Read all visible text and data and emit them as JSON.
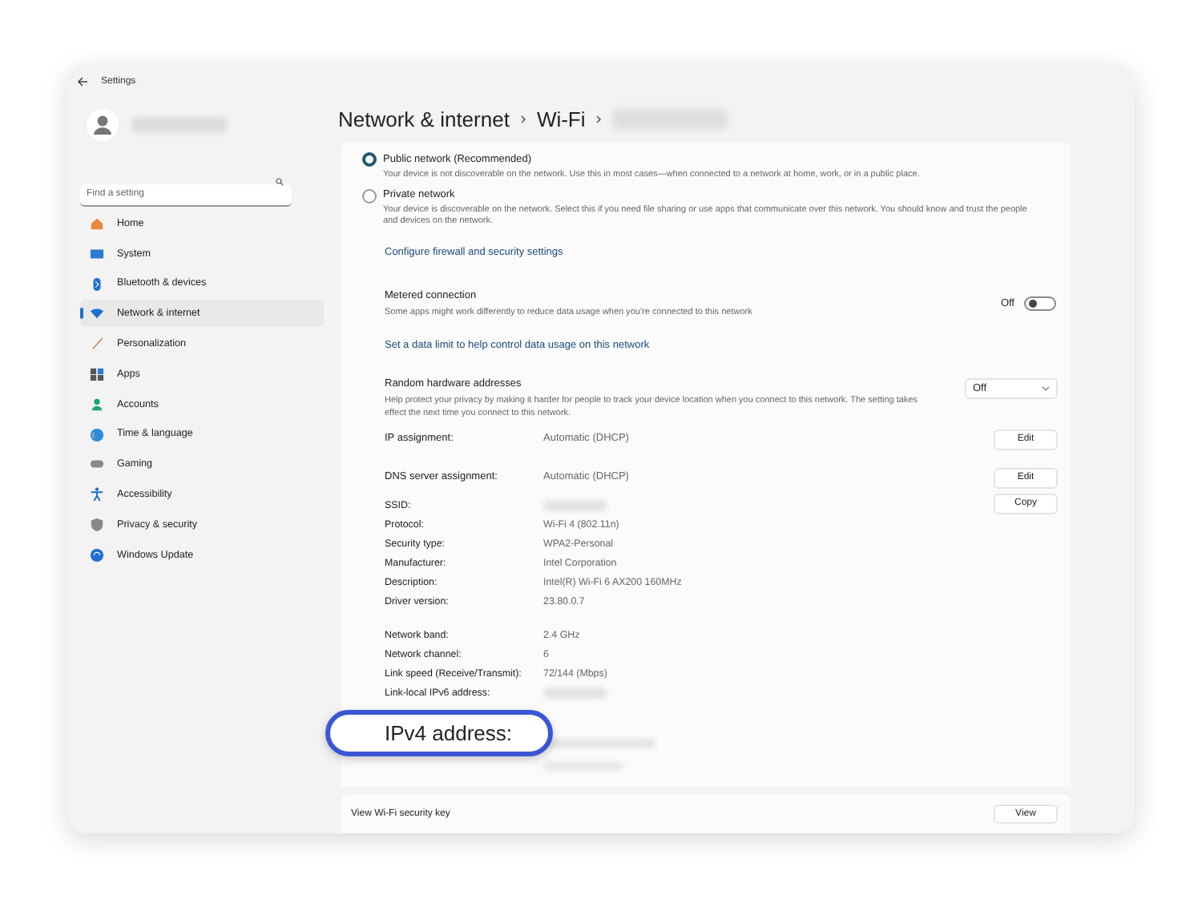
{
  "window": {
    "title": "Settings"
  },
  "sidebar": {
    "search": {
      "placeholder": "Find a setting"
    },
    "items": [
      {
        "label": "Home",
        "selected": false
      },
      {
        "label": "System",
        "selected": false
      },
      {
        "label": "Bluetooth & devices",
        "selected": false
      },
      {
        "label": "Network & internet",
        "selected": true
      },
      {
        "label": "Personalization",
        "selected": false
      },
      {
        "label": "Apps",
        "selected": false
      },
      {
        "label": "Accounts",
        "selected": false
      },
      {
        "label": "Time & language",
        "selected": false
      },
      {
        "label": "Gaming",
        "selected": false
      },
      {
        "label": "Accessibility",
        "selected": false
      },
      {
        "label": "Privacy & security",
        "selected": false
      },
      {
        "label": "Windows Update",
        "selected": false
      }
    ]
  },
  "breadcrumb": [
    "Network & internet",
    "Wi-Fi"
  ],
  "network_profile": [
    {
      "label": "Public network (Recommended)",
      "description": "Your device is not discoverable on the network. Use this in most cases—when connected to a network at home, work, or in a public place.",
      "selected": true
    },
    {
      "label": "Private network",
      "description": "Your device is discoverable on the network. Select this if you need file sharing or use apps that communicate over this network. You should know and trust the people and devices on the network.",
      "selected": false
    }
  ],
  "firewall_link": "Configure firewall and security settings",
  "metered_connection": {
    "title": "Metered connection",
    "description": "Some apps might work differently to reduce data usage when you're connected to this network",
    "state_label": "Off",
    "on": false
  },
  "data_limit_link": "Set a data limit to help control data usage on this network",
  "random_hardware_addresses": {
    "title": "Random hardware addresses",
    "description": "Help protect your privacy by making it harder for people to track your device location when you connect to this network. The setting takes effect the next time you connect to this network.",
    "value": "Off"
  },
  "assignments": [
    {
      "label": "IP assignment:",
      "value": "Automatic (DHCP)",
      "button": "Edit"
    },
    {
      "label": "DNS server assignment:",
      "value": "Automatic (DHCP)",
      "button": "Edit"
    }
  ],
  "properties_button": "Copy",
  "properties": [
    [
      {
        "label": "SSID:",
        "kind": "blurred"
      },
      {
        "label": "Protocol:",
        "value": "Wi-Fi 4 (802.11n)",
        "kind": "text"
      },
      {
        "label": "Security type:",
        "value": "WPA2-Personal",
        "kind": "text"
      },
      {
        "label": "Manufacturer:",
        "value": "Intel Corporation",
        "kind": "text"
      },
      {
        "label": "Description:",
        "value": "Intel(R) Wi-Fi 6 AX200 160MHz",
        "kind": "text"
      },
      {
        "label": "Driver version:",
        "value": "23.80.0.7",
        "kind": "text"
      }
    ],
    [
      {
        "label": "Network band:",
        "value": "2.4 GHz",
        "kind": "text"
      },
      {
        "label": "Network channel:",
        "value": "6",
        "kind": "text"
      },
      {
        "label": "Link speed (Receive/Transmit):",
        "value": "72/144 (Mbps)",
        "kind": "text"
      },
      {
        "label": "Link-local IPv6 address:",
        "kind": "blurred"
      }
    ]
  ],
  "highlight": {
    "label": "IPv4 address:"
  },
  "security_key": {
    "label": "View Wi-Fi security key",
    "button": "View"
  }
}
